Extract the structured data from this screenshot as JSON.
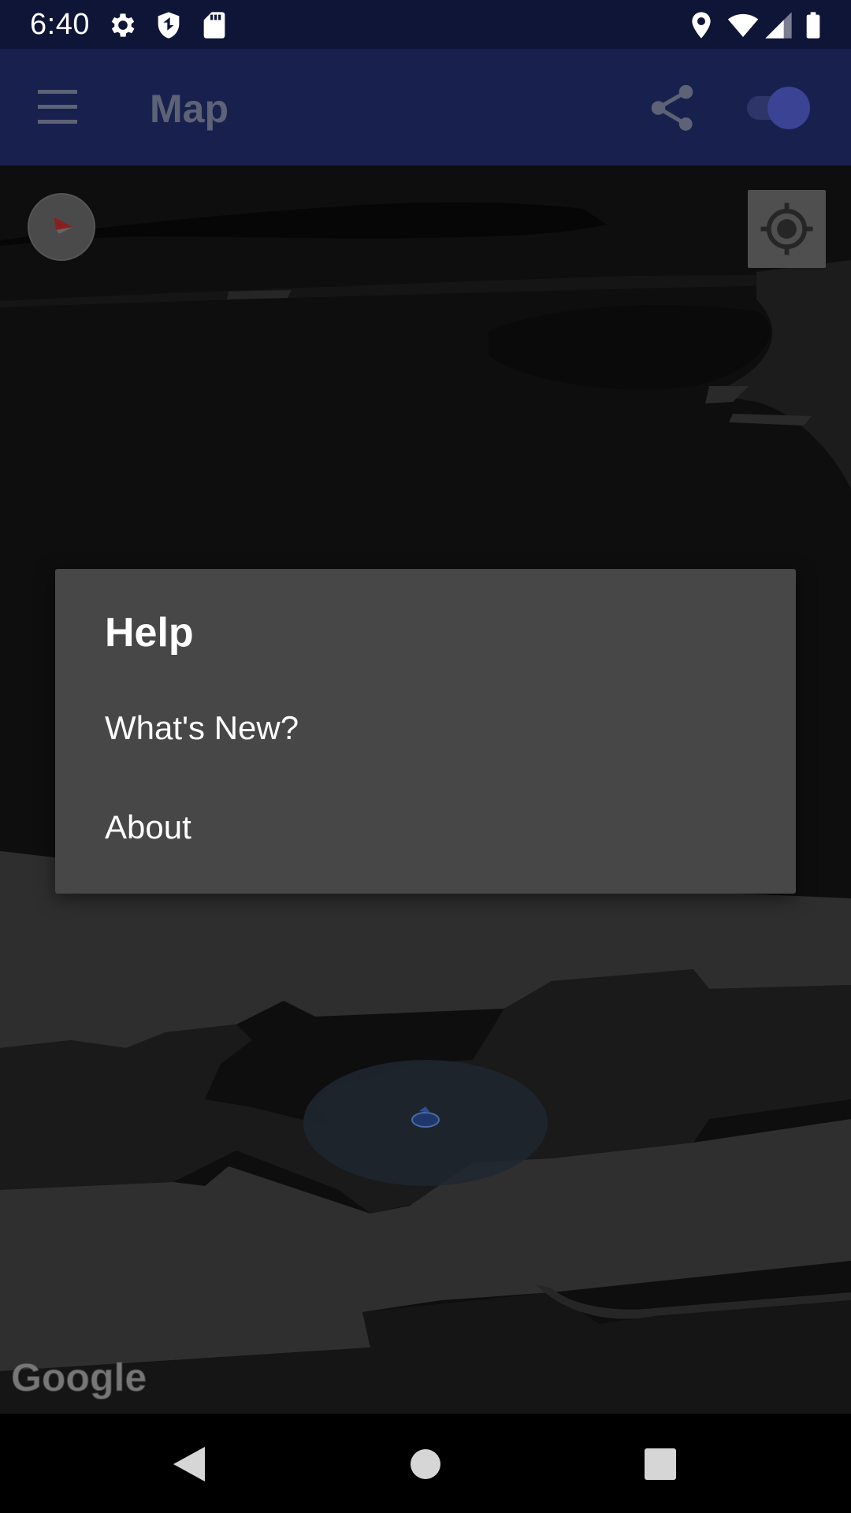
{
  "status_bar": {
    "time": "6:40",
    "left_icons": [
      "gear-icon",
      "shield-icon",
      "sd-card-icon"
    ],
    "right_icons": [
      "location-pin-icon",
      "wifi-icon",
      "cell-signal-icon",
      "battery-icon"
    ]
  },
  "app_bar": {
    "title": "Map",
    "menu_icon": "hamburger-menu-icon",
    "share_icon": "share-icon",
    "toggle_state": "on"
  },
  "map": {
    "attribution": "Google",
    "compass_icon": "compass-icon",
    "locate_icon": "my-location-icon"
  },
  "dialog": {
    "title": "Help",
    "items": [
      {
        "label": "What's New?"
      },
      {
        "label": "About"
      }
    ]
  },
  "nav_bar": {
    "buttons": [
      "back-icon",
      "home-icon",
      "recents-icon"
    ]
  },
  "colors": {
    "status_bar": "#0f1537",
    "app_bar": "#18214d",
    "dialog_bg": "#474747",
    "scrim_map": "#0d0d0d"
  }
}
